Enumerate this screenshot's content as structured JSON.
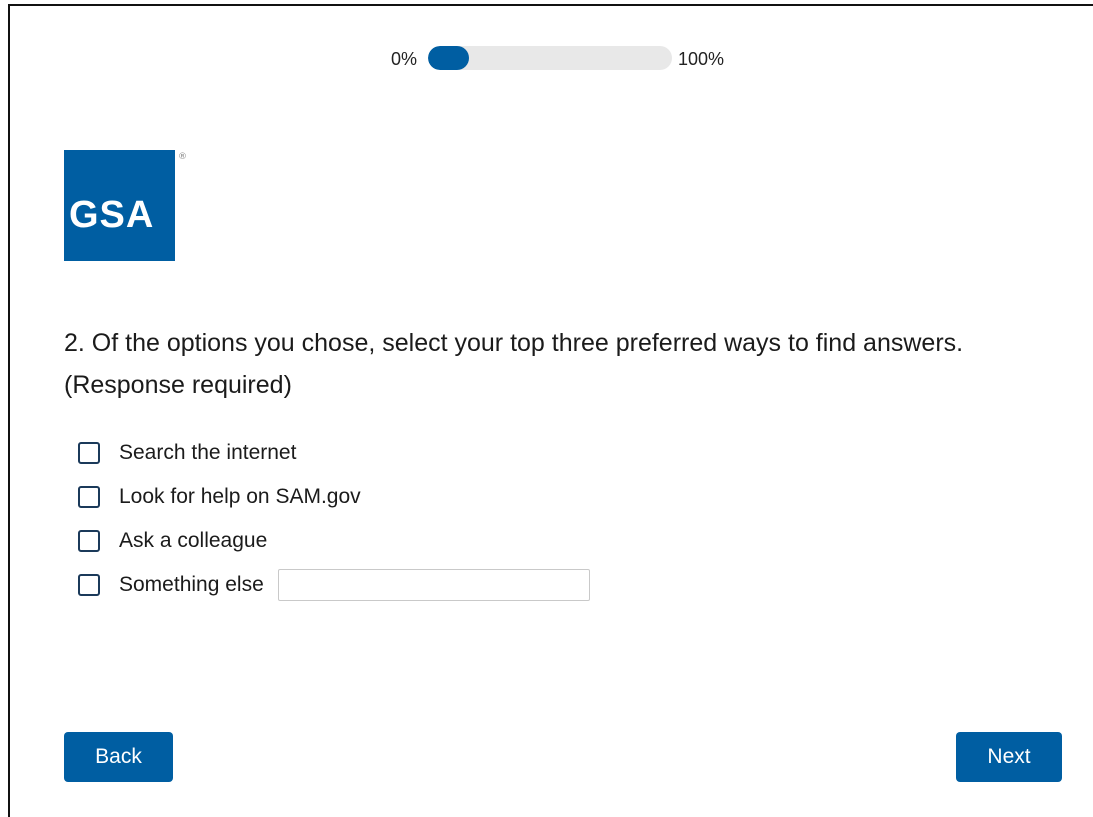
{
  "progress": {
    "min_label": "0%",
    "max_label": "100%",
    "fraction_complete": 0.17,
    "color": "#005ea2"
  },
  "logo": {
    "text": "GSA",
    "registered_mark": "®",
    "icon": "gsa-logo-star-icon",
    "color": "#005ea2"
  },
  "question": {
    "text": "2. Of the options you chose, select your top three preferred ways to find answers. (Response required)"
  },
  "options": [
    {
      "label": "Search the internet",
      "checked": false
    },
    {
      "label": "Look for help on SAM.gov",
      "checked": false
    },
    {
      "label": "Ask a colleague",
      "checked": false
    },
    {
      "label": "Something else",
      "checked": false
    }
  ],
  "other_input": {
    "value": "",
    "placeholder": ""
  },
  "nav": {
    "back_label": "Back",
    "next_label": "Next",
    "button_color": "#005ea2"
  }
}
